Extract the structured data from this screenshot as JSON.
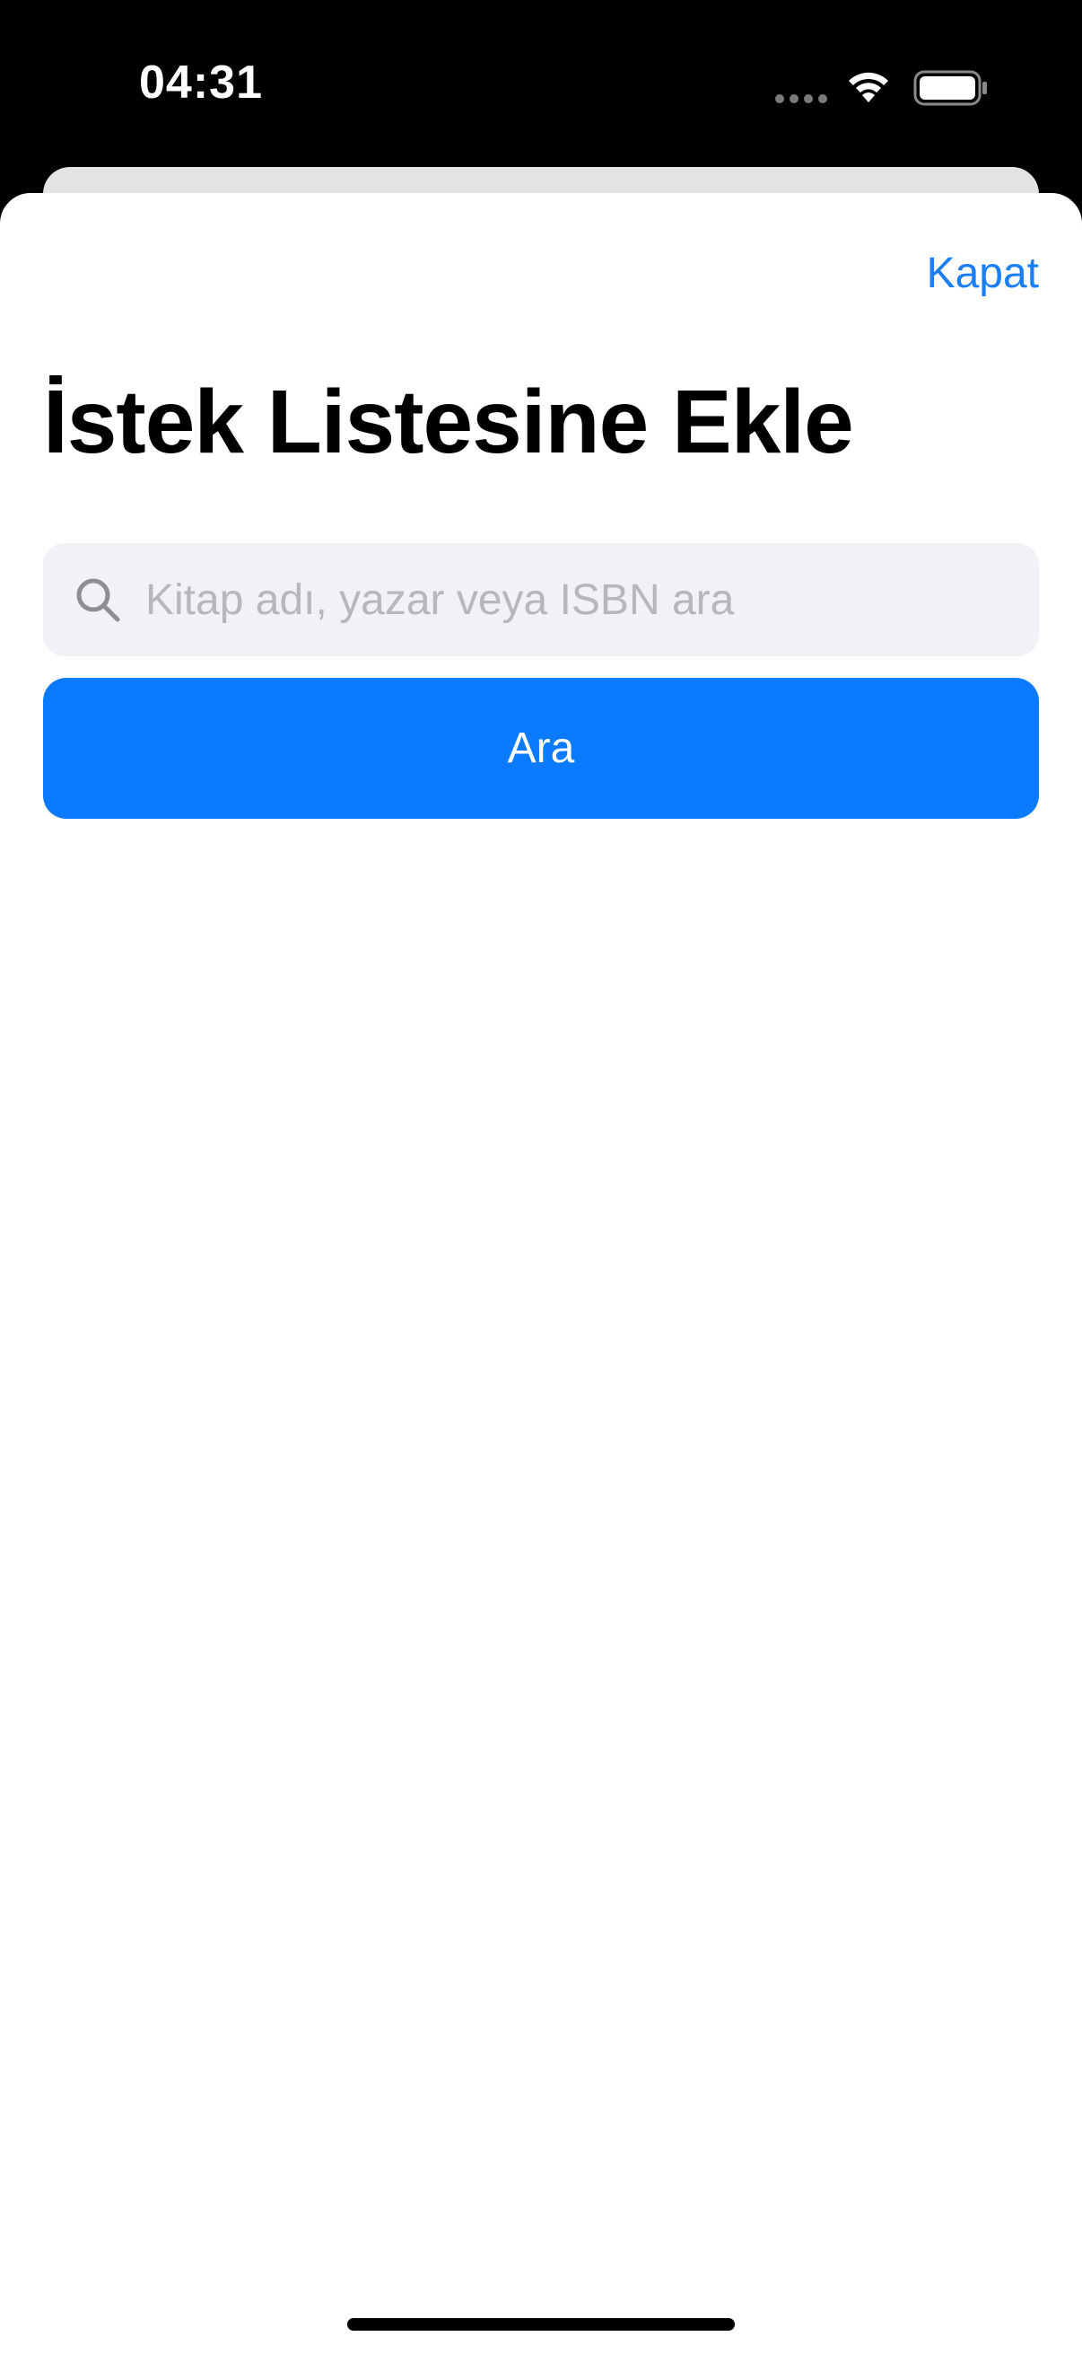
{
  "status_bar": {
    "time": "04:31",
    "icons": [
      "cellular-dots-icon",
      "wifi-icon",
      "battery-icon"
    ]
  },
  "sheet": {
    "close_label": "Kapat",
    "title": "İstek Listesine Ekle",
    "search": {
      "icon": "search-icon",
      "value": "",
      "placeholder": "Kitap adı, yazar veya ISBN ara"
    },
    "search_button_label": "Ara"
  },
  "colors": {
    "accent": "#0A7AFF",
    "link": "#1A7FF5",
    "search_background": "#F1F1F6",
    "placeholder": "#B6B6BB"
  }
}
